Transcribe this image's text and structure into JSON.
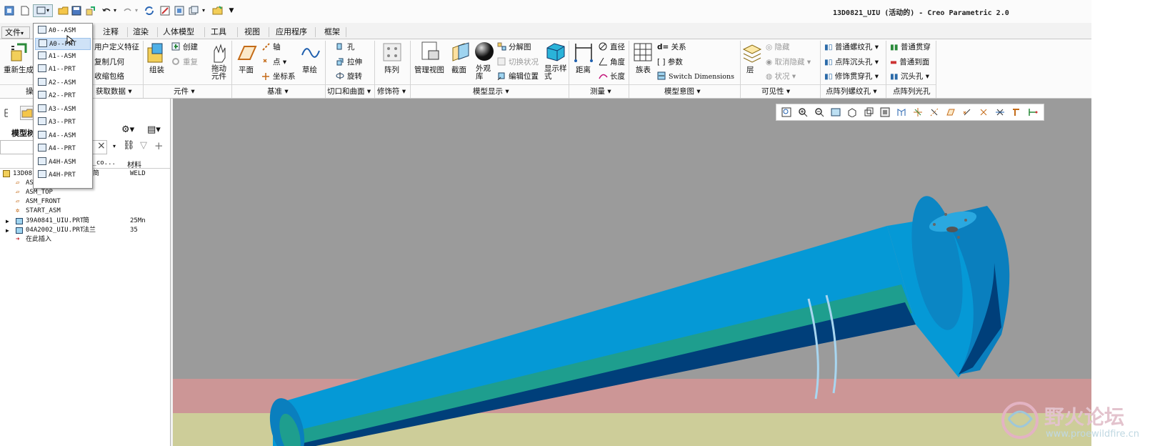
{
  "window": {
    "title": "13D0821_UIU (活动的) - Creo Parametric 2.0"
  },
  "menu_tabs": [
    "文件",
    "注释",
    "渲染",
    "人体模型",
    "工具",
    "视图",
    "应用程序",
    "框架"
  ],
  "file_tab_arrow": "▾",
  "ribbon": {
    "regenerate": "重新生成",
    "user_feature": "用户定义特征",
    "copy_geometry": "复制几何",
    "shrinkwrap": "收缩包络",
    "get_data_group": "获取数据",
    "get_data_prefix": "操",
    "assemble": "组装",
    "create": "创建",
    "repeat": "重复",
    "drag_components": "拖动\n元件",
    "component_group": "元件",
    "plane": "平面",
    "axis": "轴",
    "point": "点",
    "csys": "坐标系",
    "sketch": "草绘",
    "datum_group": "基准",
    "hole": "孔",
    "extrude": "拉伸",
    "revolve": "旋转",
    "cut_surface_group": "切口和曲面",
    "pattern": "阵列",
    "modifiers_group": "修饰符",
    "manage_views": "管理视图",
    "section": "截面",
    "appearance": "外观\n库",
    "explode_view": "分解图",
    "toggle_status": "切换状况",
    "edit_position": "编辑位置",
    "display_style": "显示样\n式",
    "model_display_group": "模型显示",
    "distance": "距离",
    "diameter": "直径",
    "angle": "角度",
    "length": "长度",
    "measure_group": "测量",
    "table": "族表",
    "relations": "关系",
    "parameters": "参数",
    "switch_dimensions": "Switch Dimensions",
    "model_intent_group": "模型意图",
    "layer": "层",
    "hide": "隐藏",
    "unhide": "取消隐藏",
    "status": "状况",
    "visibility_group": "可见性",
    "thread_hole": "普通螺纹孔",
    "pattern_counterbore": "点阵沉头孔",
    "cosmetic_thread": "修饰贯穿孔",
    "pattern_thread_group": "点阵列螺纹孔",
    "through_hole": "普通贯穿",
    "to_surface": "普通到面",
    "counterbore": "沉头孔",
    "pattern_cb_group": "点阵列光孔"
  },
  "dropdown_items": [
    "A0--ASM",
    "A0--PRT",
    "A1--ASM",
    "A1--PRT",
    "A2--ASM",
    "A2--PRT",
    "A3--ASM",
    "A3--PRT",
    "A4--ASM",
    "A4--PRT",
    "A4H-ASM",
    "A4H-PRT"
  ],
  "dropdown_selected_index": 1,
  "model_tree": {
    "title": "模型树",
    "title_visible": "模型树",
    "col_name_partial": "e_co...",
    "col_material": "材料",
    "root": {
      "name": "13D08",
      "desc": "简",
      "material": "WELD"
    },
    "items": [
      {
        "name": "ASM_SIDE",
        "desc": "",
        "material": "",
        "icon": "datum-plane"
      },
      {
        "name": "ASM_TOP",
        "desc": "",
        "material": "",
        "icon": "datum-plane"
      },
      {
        "name": "ASM_FRONT",
        "desc": "",
        "material": "",
        "icon": "datum-plane"
      },
      {
        "name": "START_ASM",
        "desc": "",
        "material": "",
        "icon": "csys"
      },
      {
        "name": "39A0841_UIU.PRT",
        "desc": "简",
        "material": "25Mn",
        "icon": "part"
      },
      {
        "name": "04A2002_UIU.PRT",
        "desc": "法兰",
        "material": "35",
        "icon": "part"
      },
      {
        "name": "在此插入",
        "desc": "",
        "material": "",
        "icon": "insert-arrow"
      }
    ]
  },
  "watermark": {
    "title": "野火论坛",
    "url": "www.proewildfire.cn"
  },
  "colors": {
    "viewport_bg": "#9b9b9b",
    "floor_pink": "#cc9696",
    "floor_yellow": "#cdcd99",
    "part_blue": "#0599d6",
    "part_dark": "#003f7a",
    "part_green": "#1e9e8e"
  }
}
